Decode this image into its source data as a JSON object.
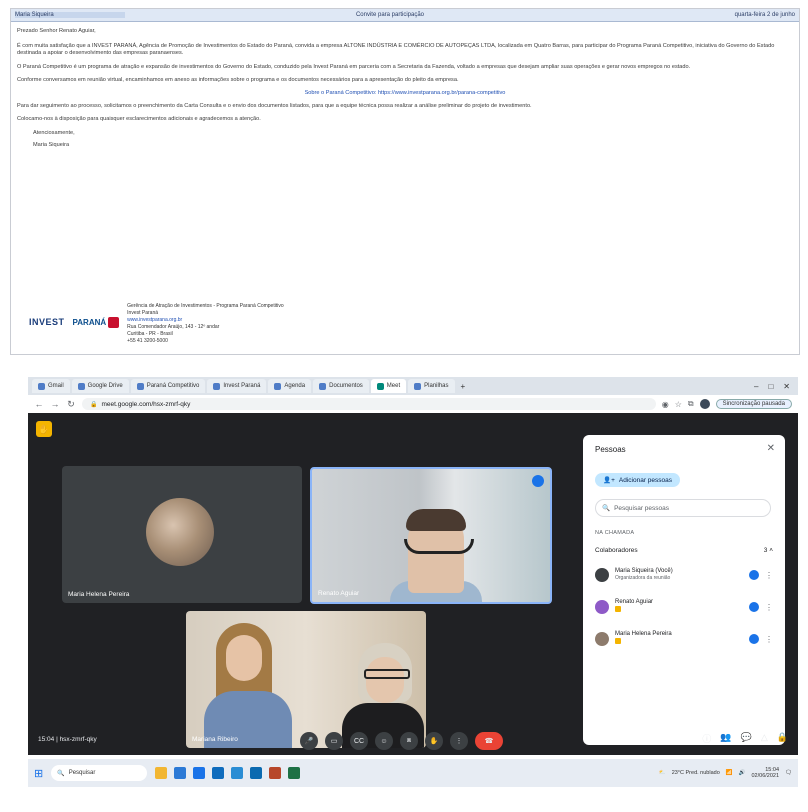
{
  "email": {
    "header": {
      "from": "Maria Siqueira",
      "subject": "Convite para participação",
      "date": "quarta-feira 2 de junho"
    },
    "greeting": "Prezado Senhor Renato Aguiar,",
    "paragraphs": [
      "É com muita satisfação que a INVEST PARANÁ, Agência de Promoção de Investimentos do Estado do Paraná, convida a empresa ALTONE INDÚSTRIA E COMÉRCIO DE AUTOPEÇAS LTDA, localizada em Quatro Barras, para participar do Programa Paraná Competitivo, iniciativa do Governo do Estado destinada a apoiar o desenvolvimento das empresas paranaenses.",
      "O Paraná Competitivo é um programa de atração e expansão de investimentos do Governo do Estado, conduzido pela Invest Paraná em parceria com a Secretaria da Fazenda, voltado a empresas que desejam ampliar suas operações e gerar novos empregos no estado.",
      "Conforme conversamos em reunião virtual, encaminhamos em anexo as informações sobre o programa e os documentos necessários para a apresentação do pleito da empresa.",
      "Sobre o Paraná Competitivo: https://www.investparana.org.br/parana-competitivo",
      "Para dar seguimento ao processo, solicitamos o preenchimento da Carta Consulta e o envio dos documentos listados, para que a equipe técnica possa realizar a análise preliminar do projeto de investimento.",
      "Colocamo-nos à disposição para quaisquer esclarecimentos adicionais e agradecemos a atenção."
    ],
    "closing": "Atenciosamente,",
    "signature": "Maria Siqueira",
    "sig_block": {
      "logo_left": "INVEST",
      "logo_right": "PARANÁ",
      "lines": [
        "Gerência de Atração de Investimentos - Programa Paraná Competitivo",
        "Invest Paraná",
        "www.investparana.org.br",
        "Rua Comendador Araújo, 143 - 12º andar",
        "Curitiba - PR - Brasil",
        "+55 41 3200-5000"
      ]
    }
  },
  "browser": {
    "tabs": [
      "Meet",
      "Gmail",
      "Google Drive",
      "Paraná Competitivo",
      "Invest Paraná",
      "Agenda",
      "Documentos",
      "Planilhas"
    ],
    "active_tab": "Meet",
    "url": "meet.google.com/hsx-zmrf-qky",
    "paused_label": "Sincronização pausada"
  },
  "meet": {
    "participants": {
      "tile1": "Maria Helena Pereira",
      "tile2": "Renato Aguiar",
      "tile3": "Mariana Ribeiro"
    },
    "people_panel": {
      "title": "Pessoas",
      "add_label": "Adicionar pessoas",
      "search_placeholder": "Pesquisar pessoas",
      "section_label": "NA CHAMADA",
      "contrib_label": "Colaboradores",
      "contrib_count": "3",
      "rows": [
        {
          "name": "Maria Siqueira (Você)",
          "sub": "Organizadora da reunião"
        },
        {
          "name": "Renato Aguiar",
          "sub": ""
        },
        {
          "name": "Maria Helena Pereira",
          "sub": ""
        }
      ]
    },
    "clock": "15:04  |  hsx-zmrf-qky"
  },
  "taskbar": {
    "search_placeholder": "Pesquisar",
    "tray_text": "23°C Pred. nublado",
    "time": "15:04",
    "date": "02/06/2021"
  }
}
